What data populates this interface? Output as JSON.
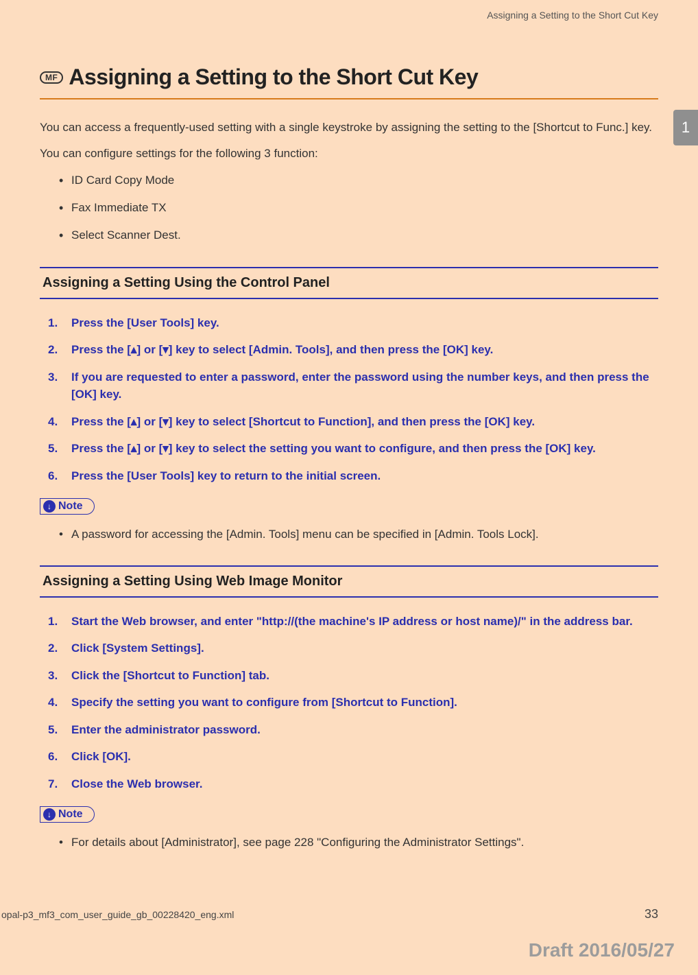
{
  "running_head": "Assigning a Setting to the Short Cut Key",
  "side_tab": "1",
  "badge": "MF",
  "title": "Assigning a Setting to the Short Cut Key",
  "intro_p1": "You can access a frequently-used setting with a single keystroke by assigning the setting to the [Shortcut to Func.] key.",
  "intro_p2": "You can configure settings for the following 3 function:",
  "intro_bullets": [
    "ID Card Copy Mode",
    "Fax Immediate TX",
    "Select Scanner Dest."
  ],
  "section1": {
    "heading": "Assigning a Setting Using the Control Panel",
    "steps": [
      "Press the [User Tools] key.",
      "Press the [▴] or [▾] key to select [Admin. Tools], and then press the [OK] key.",
      "If you are requested to enter a password, enter the password using the number keys, and then press the [OK] key.",
      "Press the [▴] or [▾] key to select [Shortcut to Function], and then press the [OK] key.",
      "Press the [▴] or [▾] key to select the setting you want to configure, and then press the [OK] key.",
      "Press the [User Tools] key to return to the initial screen."
    ],
    "note_label": "Note",
    "note_items": [
      "A password for accessing the [Admin. Tools] menu can be specified in [Admin. Tools Lock]."
    ]
  },
  "section2": {
    "heading": "Assigning a Setting Using Web Image Monitor",
    "steps": [
      "Start the Web browser, and enter \"http://(the machine's IP address or host name)/\" in the address bar.",
      "Click [System Settings].",
      "Click the [Shortcut to Function] tab.",
      "Specify the setting you want to configure from [Shortcut to Function].",
      "Enter the administrator password.",
      "Click [OK].",
      "Close the Web browser."
    ],
    "note_label": "Note",
    "note_items": [
      "For details about [Administrator], see page 228 \"Configuring the Administrator Settings\"."
    ]
  },
  "footer_file": "opal-p3_mf3_com_user_guide_gb_00228420_eng.xml",
  "footer_page": "33",
  "draft": "Draft 2016/05/27"
}
